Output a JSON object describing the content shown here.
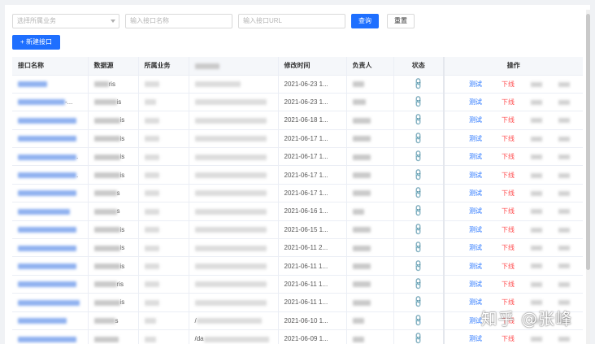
{
  "filters": {
    "business_select_placeholder": "选择所属业务",
    "api_name_placeholder": "输入接口名称",
    "url_placeholder": "输入接口URL",
    "query_label": "查询",
    "reset_label": "重置"
  },
  "new_button_label": "+ 新建接口",
  "table": {
    "headers": {
      "name": "接口名称",
      "datasource": "数据源",
      "business": "所属业务",
      "modified": "修改时间",
      "owner": "负责人",
      "status": "状态",
      "ops": "操作"
    },
    "rows": [
      {
        "name_suffix": "",
        "ds_suffix": "ris",
        "url_prefix": "",
        "modified": "2021-06-23 1..."
      },
      {
        "name_suffix": "-...",
        "ds_suffix": "is",
        "url_prefix": "",
        "modified": "2021-06-23 1..."
      },
      {
        "name_suffix": "",
        "ds_suffix": "is",
        "url_prefix": "",
        "modified": "2021-06-18 1..."
      },
      {
        "name_suffix": "",
        "ds_suffix": "is",
        "url_prefix": "",
        "modified": "2021-06-17 1..."
      },
      {
        "name_suffix": ".",
        "ds_suffix": "is",
        "url_prefix": "",
        "modified": "2021-06-17 1..."
      },
      {
        "name_suffix": ".",
        "ds_suffix": "is",
        "url_prefix": "",
        "modified": "2021-06-17 1..."
      },
      {
        "name_suffix": "",
        "ds_suffix": "s",
        "url_prefix": "",
        "modified": "2021-06-17 1..."
      },
      {
        "name_suffix": "",
        "ds_suffix": "s",
        "url_prefix": "",
        "modified": "2021-06-16 1..."
      },
      {
        "name_suffix": "",
        "ds_suffix": "is",
        "url_prefix": "",
        "modified": "2021-06-15 1..."
      },
      {
        "name_suffix": "",
        "ds_suffix": "is",
        "url_prefix": "",
        "modified": "2021-06-11 2..."
      },
      {
        "name_suffix": "",
        "ds_suffix": "is",
        "url_prefix": "",
        "modified": "2021-06-11 1..."
      },
      {
        "name_suffix": "",
        "ds_suffix": "ris",
        "url_prefix": "",
        "modified": "2021-06-11 1..."
      },
      {
        "name_suffix": "",
        "ds_suffix": "is",
        "url_prefix": "",
        "modified": "2021-06-11 1..."
      },
      {
        "name_suffix": "",
        "ds_suffix": "s",
        "url_prefix": "/",
        "modified": "2021-06-10 1..."
      },
      {
        "name_suffix": "",
        "ds_suffix": "",
        "url_prefix": "/da",
        "modified": "2021-06-09 1..."
      }
    ],
    "op_test_label": "测试",
    "op_offline_label": "下线",
    "status_icon": "link-icon"
  },
  "watermark": "知乎 @张峰",
  "colors": {
    "primary": "#1e6fff",
    "danger": "#ff4d4f",
    "header_bg": "#f5f7fa"
  }
}
